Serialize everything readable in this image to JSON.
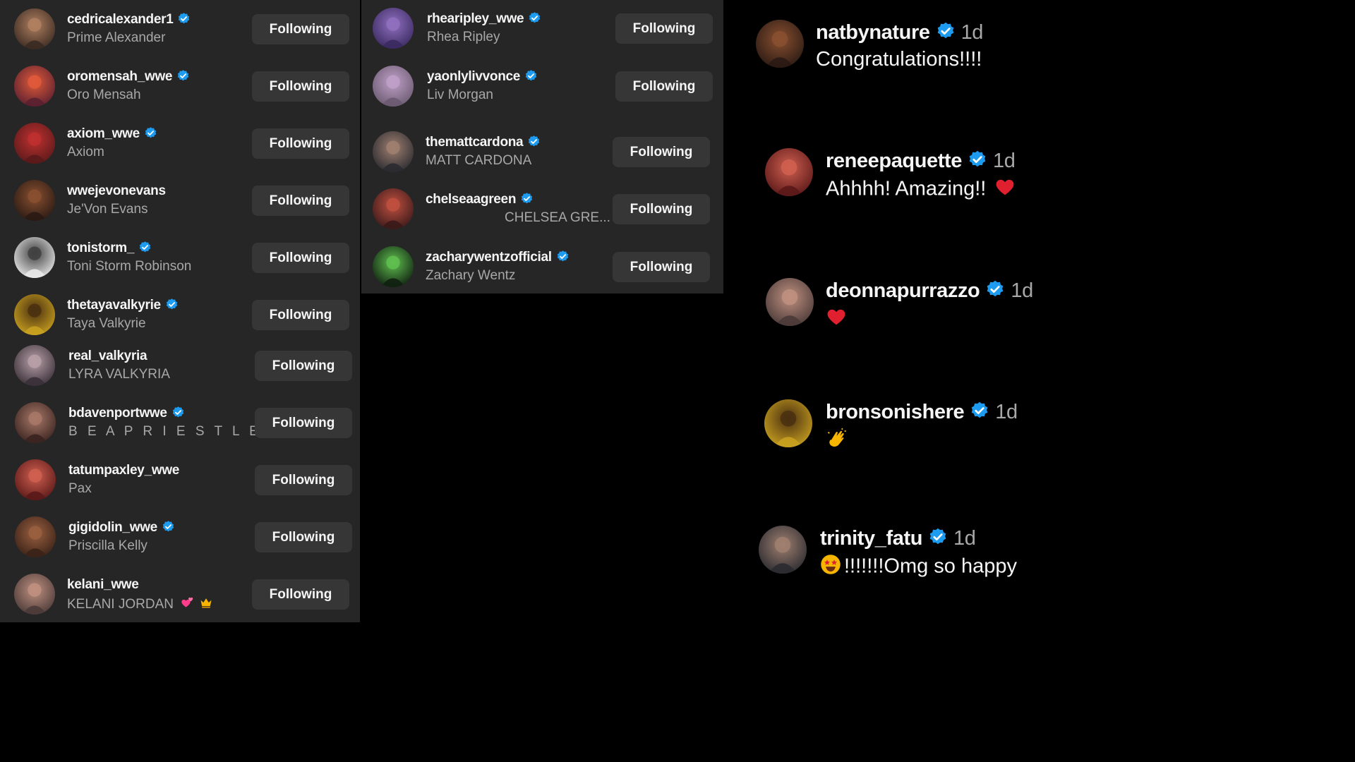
{
  "follow_label": "Following",
  "icons": {
    "verified": "verified-badge-icon",
    "heart": "red-heart-icon",
    "clap": "clapping-hands-icon",
    "star_eyes": "star-struck-face-icon",
    "pink_hearts": "two-hearts-icon",
    "crown": "crown-icon"
  },
  "colors": {
    "panel": "#262626",
    "button": "#363636",
    "verified": "#1d9bf0",
    "secondary_text": "#a8a8a8",
    "background": "#000000"
  },
  "left_list": [
    {
      "username": "cedricalexander1",
      "fullname": "Prime Alexander",
      "verified": true
    },
    {
      "username": "oromensah_wwe",
      "fullname": "Oro Mensah",
      "verified": true
    },
    {
      "username": "axiom_wwe",
      "fullname": "Axiom",
      "verified": true
    },
    {
      "username": "wwejevonevans",
      "fullname": "Je'Von Evans",
      "verified": false
    },
    {
      "username": "tonistorm_",
      "fullname": "Toni Storm Robinson",
      "verified": true
    },
    {
      "username": "thetayavalkyrie",
      "fullname": "Taya Valkyrie",
      "verified": true
    },
    {
      "username": "real_valkyria",
      "fullname": "LYRA VALKYRIA",
      "verified": false
    },
    {
      "username": "bdavenportwwe",
      "fullname": "B E A P R I E S T L E Y",
      "verified": true
    },
    {
      "username": "tatumpaxley_wwe",
      "fullname": "Pax",
      "verified": false
    },
    {
      "username": "gigidolin_wwe",
      "fullname": "Priscilla Kelly",
      "verified": true
    },
    {
      "username": "kelani_wwe",
      "fullname": "KELANI JORDAN",
      "verified": false
    }
  ],
  "mid_list": [
    {
      "username": "rhearipley_wwe",
      "fullname": "Rhea Ripley",
      "verified": true
    },
    {
      "username": "yaonlylivvonce",
      "fullname": "Liv Morgan",
      "verified": true
    },
    {
      "username": "themattcardona",
      "fullname": "MATT CARDONA",
      "verified": true
    },
    {
      "username": "chelseaagreen",
      "fullname": "CHELSEA GRE...",
      "verified": true
    },
    {
      "username": "zacharywentzofficial",
      "fullname": "Zachary Wentz",
      "verified": true
    }
  ],
  "comments": [
    {
      "username": "natbynature",
      "time": "1d",
      "text": "Congratulations!!!!"
    },
    {
      "username": "reneepaquette",
      "time": "1d",
      "text": "Ahhhh! Amazing!!"
    },
    {
      "username": "deonnapurrazzo",
      "time": "1d",
      "text": ""
    },
    {
      "username": "bronsonishere",
      "time": "1d",
      "text": ""
    },
    {
      "username": "trinity_fatu",
      "time": "1d",
      "text": "!!!!!!!Omg so happy"
    }
  ]
}
